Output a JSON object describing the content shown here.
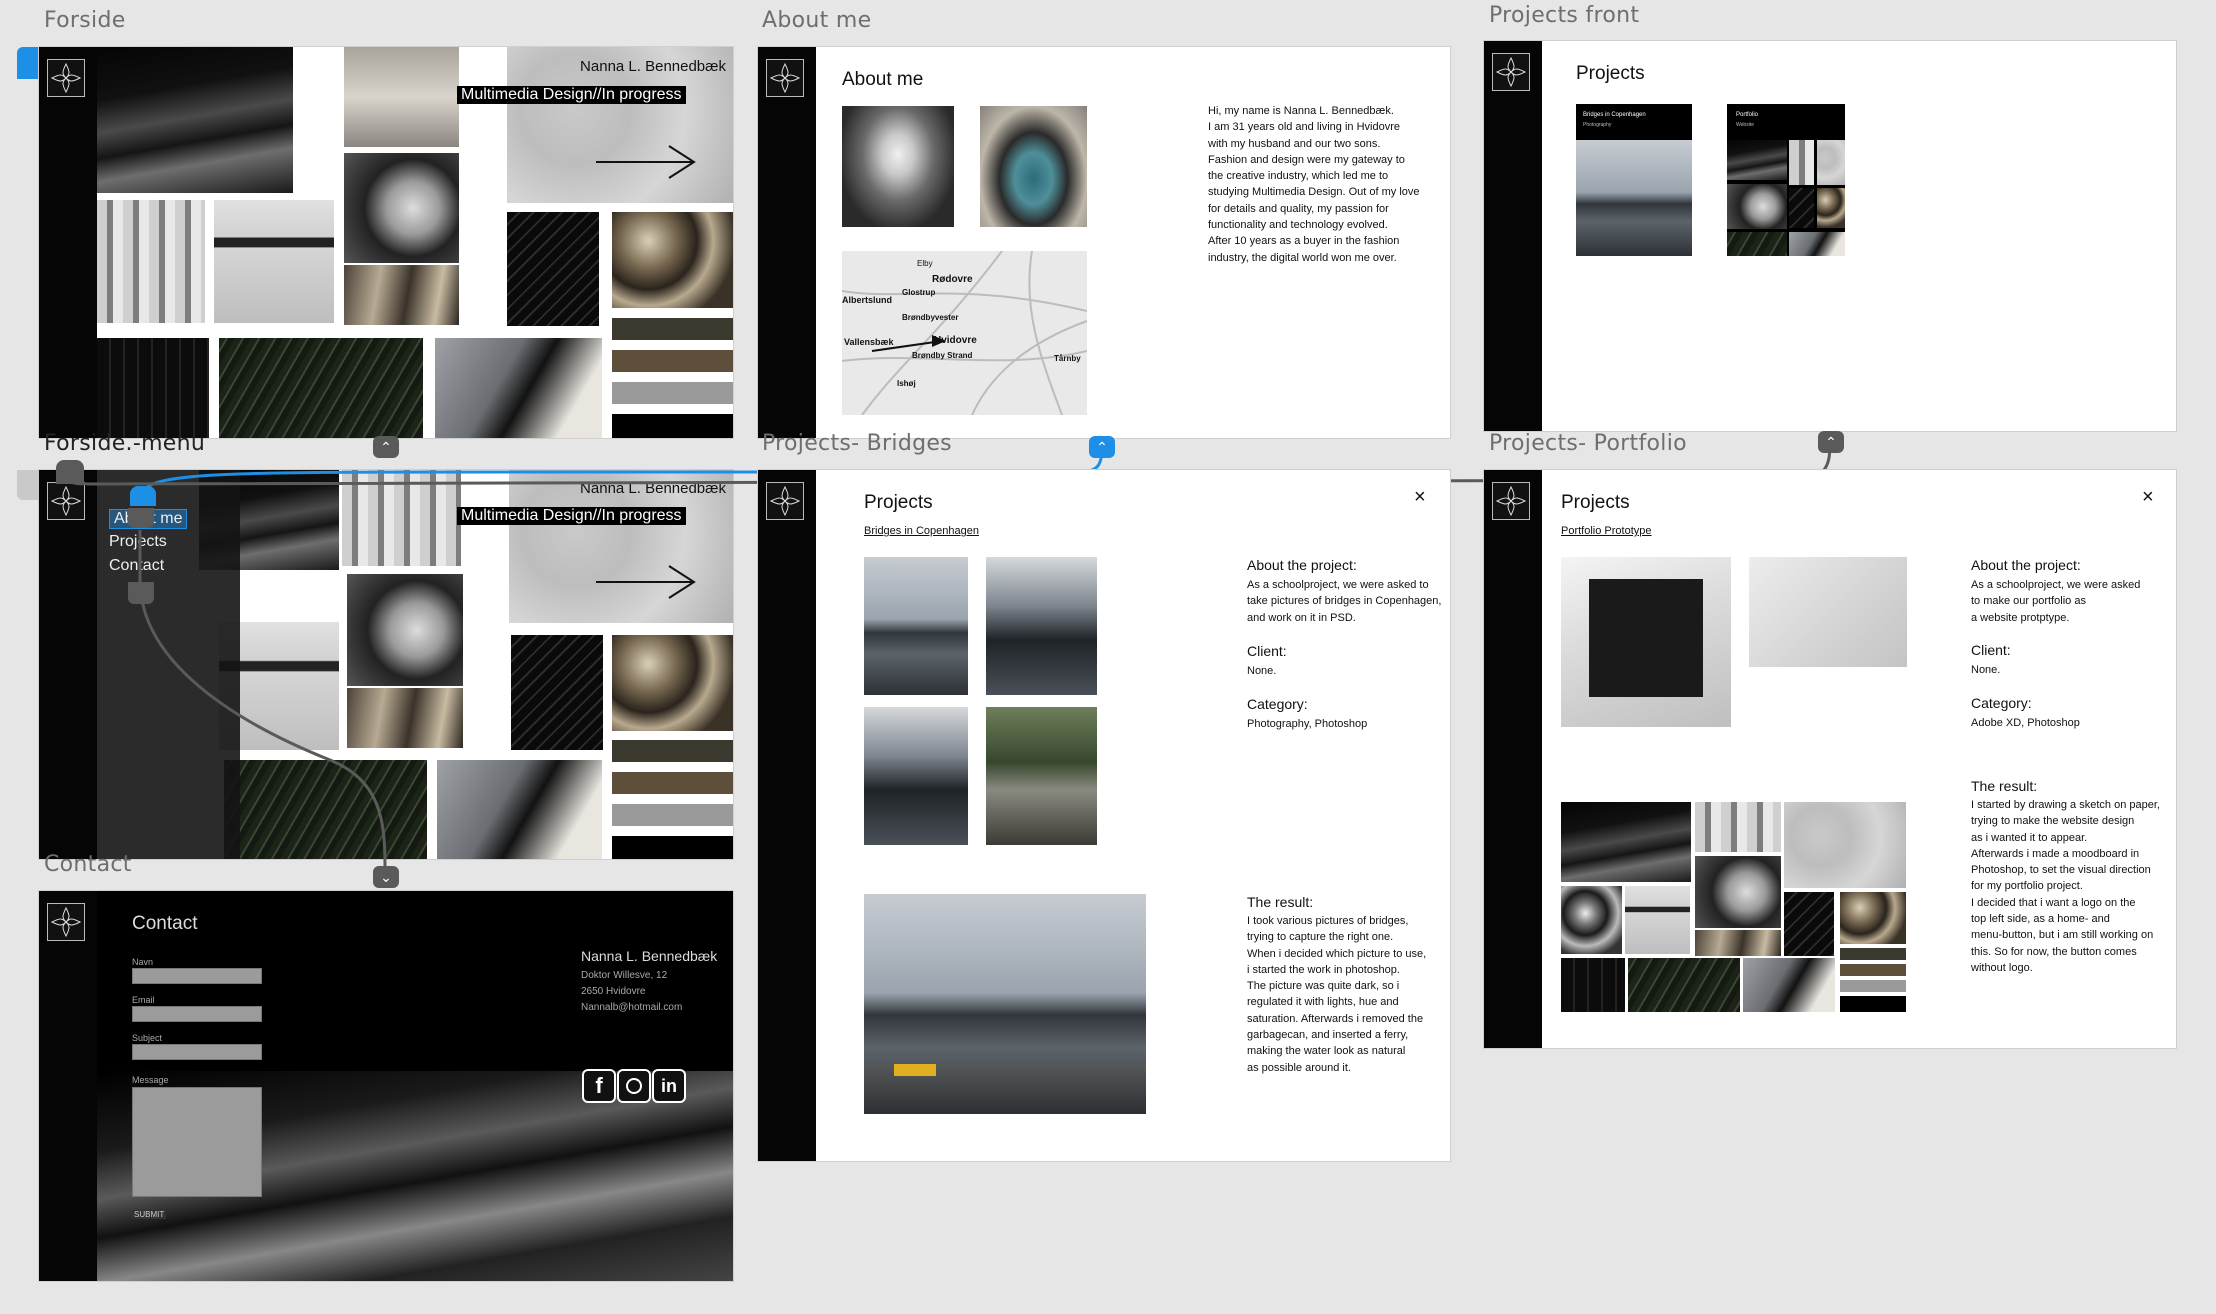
{
  "artboards": {
    "forside": {
      "label": "Forside",
      "name_heading": "Nanna L. Bennedbæk",
      "subtitle": "Multimedia Design//In progress"
    },
    "about": {
      "label": "About me",
      "heading": "About me",
      "bio": [
        "Hi, my name is Nanna L. Bennedbæk.",
        "I am 31 years old and living in Hvidovre",
        "with my husband and our two sons.",
        "Fashion and design were my gateway to",
        "the creative industry, which led me to",
        "studying Multimedia Design. Out of my love",
        "for details and quality, my passion for",
        "functionality and technology evolved.",
        "After 10 years as a buyer in the fashion",
        "industry, the digital world won me over."
      ],
      "map_labels": [
        "Rødovre",
        "Glostrup",
        "Brøndbyvester",
        "Hvidovre",
        "Brøndby Strand",
        "Ishøj",
        "Tårnby",
        "Elby",
        "Albertslund",
        "Vallensbæk"
      ]
    },
    "projects_front": {
      "label": "Projects front",
      "heading": "Projects",
      "cards": [
        {
          "title": "Bridges in Copenhagen",
          "sub": "Photography"
        },
        {
          "title": "Portfolio",
          "sub": "Website"
        }
      ]
    },
    "forside_menu": {
      "label": "Forside.-menu",
      "name_heading": "Nanna L. Bennedbæk",
      "subtitle": "Multimedia Design//In progress",
      "menu": [
        "About me",
        "Projects",
        "Contact"
      ]
    },
    "bridges": {
      "label": "Projects- Bridges",
      "heading": "Projects",
      "link": "Bridges in Copenhagen",
      "close": "×",
      "about_title": "About the project:",
      "about_lines": [
        "As a schoolproject, we were asked to",
        "take pictures of bridges in Copenhagen,",
        "and work on it in PSD."
      ],
      "client_title": "Client:",
      "client": "None.",
      "category_title": "Category:",
      "category": "Photography, Photoshop",
      "result_title": "The result:",
      "result_lines": [
        "I took various pictures of bridges,",
        "trying to capture the right one.",
        "When i decided which picture to use,",
        "i started the work in photoshop.",
        "The picture was quite dark, so i",
        "regulated it with lights, hue and",
        "saturation. Afterwards i removed the",
        "garbagecan, and inserted a ferry,",
        "making the water look as natural",
        "as possible around it."
      ]
    },
    "portfolio": {
      "label": "Projects- Portfolio",
      "heading": "Projects",
      "link": "Portfolio Prototype",
      "close": "×",
      "about_title": "About the project:",
      "about_lines": [
        "As a schoolproject, we were asked",
        "to make our portfolio as",
        "a website protptype."
      ],
      "client_title": "Client:",
      "client": "None.",
      "category_title": "Category:",
      "category": "Adobe XD, Photoshop",
      "result_title": "The result:",
      "result_lines": [
        "I started by drawing a sketch on paper,",
        "trying to make the website design",
        "as i wanted it to appear.",
        "Afterwards i made a moodboard in",
        "Photoshop, to set the visual direction",
        "for my portfolio project.",
        "I decided that i want a logo on the",
        "top left side, as a home- and",
        "menu-button, but i am still working on",
        "this. So for now, the button comes",
        "without logo."
      ]
    },
    "contact": {
      "label": "Contact",
      "heading": "Contact",
      "fields": [
        "Navn",
        "Email",
        "Subject",
        "Message"
      ],
      "submit": "SUBMIT",
      "address": [
        "Nanna L. Bennedbæk",
        "Doktor Willesve, 12",
        "2650 Hvidovre",
        "Nannalb@hotmail.com"
      ],
      "social": [
        "facebook-icon",
        "instagram-icon",
        "linkedin-icon"
      ]
    }
  },
  "colors": {
    "wire_blue": "#1e8fe6",
    "wire_grey": "#5a5a5a",
    "canvas": "#e6e6e6"
  }
}
